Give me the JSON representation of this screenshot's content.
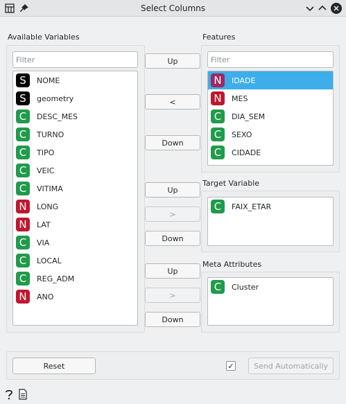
{
  "window": {
    "title": "Select Columns",
    "controls": [
      "chevron-down-icon",
      "chevron-up-icon",
      "close-icon"
    ]
  },
  "available": {
    "label": "Available Variables",
    "filter_placeholder": "Filter",
    "items": [
      {
        "badge": "S",
        "name": "NOME",
        "color": "#000000"
      },
      {
        "badge": "S",
        "name": "geometry",
        "color": "#000000"
      },
      {
        "badge": "C",
        "name": "DESC_MES",
        "color": "#1f9b4a"
      },
      {
        "badge": "C",
        "name": "TURNO",
        "color": "#1f9b4a"
      },
      {
        "badge": "C",
        "name": "TIPO",
        "color": "#1f9b4a"
      },
      {
        "badge": "C",
        "name": "VEIC",
        "color": "#1f9b4a"
      },
      {
        "badge": "C",
        "name": "VITIMA",
        "color": "#1f9b4a"
      },
      {
        "badge": "N",
        "name": "LONG",
        "color": "#c0172c"
      },
      {
        "badge": "N",
        "name": "LAT",
        "color": "#c0172c"
      },
      {
        "badge": "C",
        "name": "VIA",
        "color": "#1f9b4a"
      },
      {
        "badge": "C",
        "name": "LOCAL",
        "color": "#1f9b4a"
      },
      {
        "badge": "C",
        "name": "REG_ADM",
        "color": "#1f9b4a"
      },
      {
        "badge": "N",
        "name": "ANO",
        "color": "#c0172c"
      }
    ]
  },
  "features": {
    "label": "Features",
    "filter_placeholder": "Filter",
    "items": [
      {
        "badge": "N",
        "name": "IDADE",
        "color": "#9b2b62",
        "selected": true
      },
      {
        "badge": "N",
        "name": "MES",
        "color": "#c0172c"
      },
      {
        "badge": "C",
        "name": "DIA_SEM",
        "color": "#1f9b4a"
      },
      {
        "badge": "C",
        "name": "SEXO",
        "color": "#1f9b4a"
      },
      {
        "badge": "C",
        "name": "CIDADE",
        "color": "#1f9b4a"
      }
    ]
  },
  "target": {
    "label": "Target Variable",
    "items": [
      {
        "badge": "C",
        "name": "FAIX_ETAR",
        "color": "#1f9b4a"
      }
    ]
  },
  "meta": {
    "label": "Meta Attributes",
    "items": [
      {
        "badge": "C",
        "name": "Cluster",
        "color": "#1f9b4a"
      }
    ]
  },
  "buttons": {
    "features_up": "Up",
    "features_move": "<",
    "features_down": "Down",
    "target_up": "Up",
    "target_move": ">",
    "target_down": "Down",
    "meta_up": "Up",
    "meta_move": ">",
    "meta_down": "Down",
    "reset": "Reset",
    "send_auto": "Send Automatically"
  },
  "auto_send_checked": true,
  "auto_send_check_glyph": "✓",
  "footer_icons": [
    "help-icon",
    "report-icon"
  ]
}
